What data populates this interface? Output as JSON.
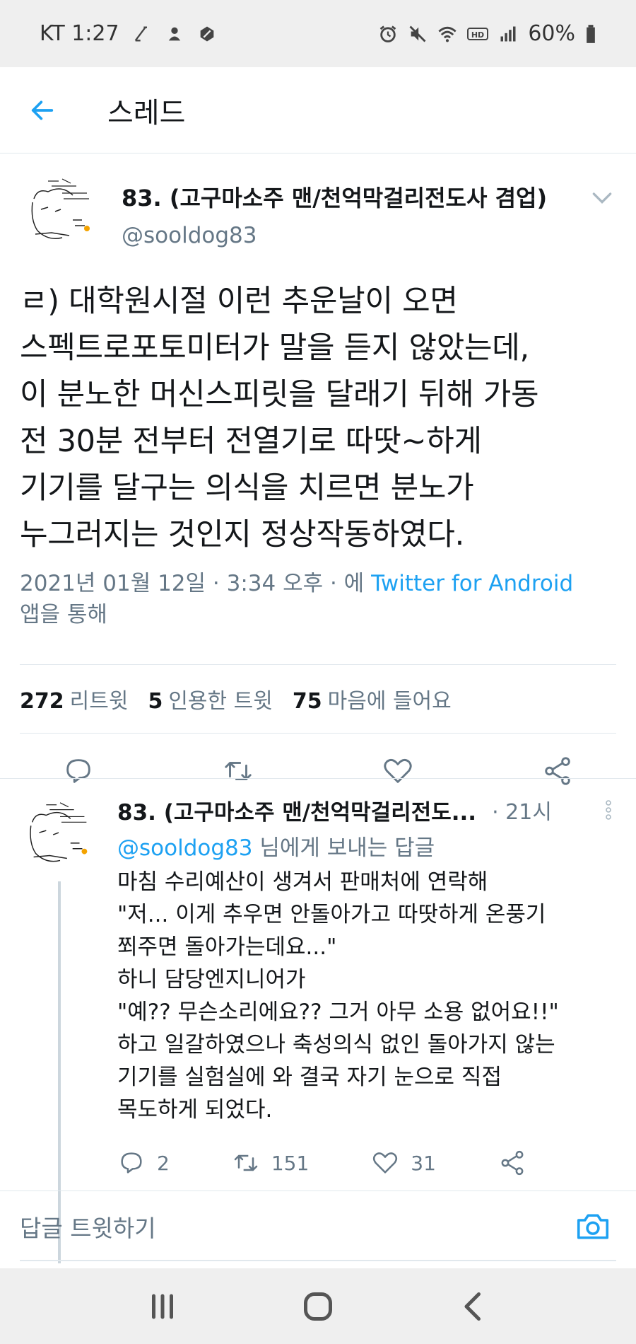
{
  "status_bar": {
    "carrier_time": "KT 1:27",
    "battery": "60%"
  },
  "app_bar": {
    "title": "스레드"
  },
  "main_tweet": {
    "author_name": "83. (고구마소주 맨/천억막걸리전도사 겸업)",
    "handle": "@sooldog83",
    "text": "ㄹ) 대학원시절 이런 추운날이 오면\n스펙트로포토미터가 말을 듣지 않았는데,\n이 분노한 머신스피릿을 달래기 뒤해 가동\n전 30분 전부터 전열기로 따땃~하게\n기기를 달구는 의식을 치르면 분노가\n누그러지는 것인지 정상작동하였다.",
    "timestamp_prefix": "2021년 01월 12일 · 3:34 오후 · 에 ",
    "source": "Twitter for Android",
    "timestamp_suffix": "앱을 통해",
    "stats": {
      "retweets_count": "272",
      "retweets_label": "리트윗",
      "quotes_count": "5",
      "quotes_label": "인용한 트윗",
      "likes_count": "75",
      "likes_label": "마음에 들어요"
    }
  },
  "reply": {
    "author_name": "83. (고구마소주 맨/천억막걸리전도...",
    "time": "· 21시",
    "reply_to_mention": "@sooldog83",
    "reply_to_suffix": " 님에게 보내는 답글",
    "text": "마침 수리예산이 생겨서 판매처에 연락해\n\"저... 이게 추우면 안돌아가고 따땃하게 온풍기\n쬐주면 돌아가는데요...\"\n하니 담당엔지니어가\n\"예?? 무슨소리에요?? 그거 아무 소용 없어요!!\"\n하고 일갈하였으나 축성의식 없인 돌아가지 않는\n기기를 실험실에 와 결국 자기 눈으로 직접\n목도하게 되었다.",
    "reply_count": "2",
    "retweet_count": "151",
    "like_count": "31"
  },
  "composer": {
    "placeholder": "답글 트윗하기"
  },
  "colors": {
    "accent": "#1da1f2",
    "secondary_text": "#657786",
    "primary_text": "#14171a",
    "divider": "#e1e8ed"
  },
  "icons": [
    "back-arrow-icon",
    "chevron-down-icon",
    "reply-icon",
    "retweet-icon",
    "like-icon",
    "share-icon",
    "more-vertical-icon",
    "camera-icon",
    "recents-icon",
    "home-icon",
    "back-icon"
  ]
}
